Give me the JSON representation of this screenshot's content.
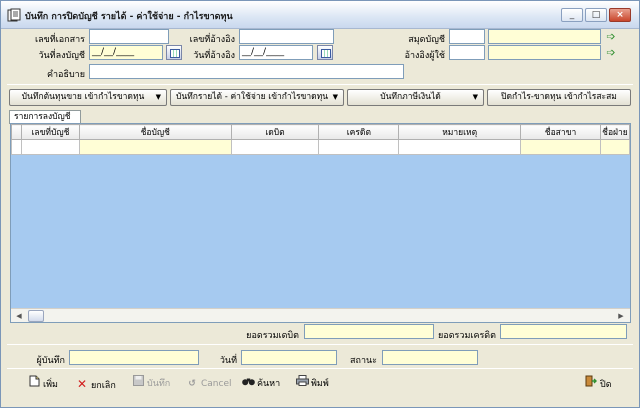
{
  "window": {
    "title": "บันทึก การปิดบัญชี รายได้ - ค่าใช้จ่าย - กำไรขาดทุน",
    "controls": {
      "minimize": "_",
      "maximize": "□",
      "close": "×"
    }
  },
  "form": {
    "doc_no_label": "เลขที่เอกสาร",
    "doc_no_value": "",
    "ref_no_label": "เลขที่อ้างอิง",
    "ref_no_value": "",
    "journal_label": "สมุดบัญชี",
    "journal_code": "",
    "journal_name": "",
    "post_date_label": "วันที่ลงบัญชี",
    "post_date_value": "__/__/____",
    "ref_date_label": "วันที่อ้างอิง",
    "ref_date_value": "__/__/____",
    "ref_person_label": "อ้างอิงผู้ใช้",
    "ref_person_code": "",
    "ref_person_name": "",
    "desc_label": "คำอธิบาย",
    "desc_value": ""
  },
  "toolbar": {
    "btn1": "บันทึกต้นทุนขาย เข้ากำไรขาดทุน",
    "btn2": "บันทึกรายได้ - ค่าใช้จ่าย เข้ากำไรขาดทุน",
    "btn3": "บันทึกภาษีเงินได้",
    "btn4": "ปิดกำไร-ขาดทุน เข้ากำไรสะสม",
    "dropdown_arrow": "▼"
  },
  "tab": {
    "label": "รายการลงบัญชี"
  },
  "grid": {
    "columns": [
      "เลขที่บัญชี",
      "ชื่อบัญชี",
      "เดบิต",
      "เครดิต",
      "หมายเหตุ",
      "ชื่อสาขา",
      "ชื่อฝ่าย"
    ],
    "rows": [
      [
        "",
        "",
        "",
        "",
        "",
        "",
        ""
      ]
    ]
  },
  "totals": {
    "debit_label": "ยอดรวมเดบิต",
    "debit_value": "",
    "credit_label": "ยอดรวมเครดิต",
    "credit_value": ""
  },
  "footer_fields": {
    "recorder_label": "ผู้บันทึก",
    "recorder_value": "",
    "date_label": "วันที่",
    "date_value": "",
    "status_label": "สถานะ",
    "status_value": ""
  },
  "actions": {
    "add": "เพิ่ม",
    "cancel_th": "ยกเลิก",
    "save": "บันทึก",
    "cancel_en": "Cancel",
    "search": "ค้นหา",
    "print": "พิมพ์",
    "close": "ปิด"
  },
  "icons": {
    "app": "ledger-icon",
    "lookup": "arrow-right-icon",
    "calendar": "calendar-icon",
    "add": "new-document-icon",
    "cancel": "red-x-icon",
    "save": "disk-icon",
    "cancel_en": "undo-icon",
    "search": "binoculars-icon",
    "print": "printer-icon",
    "close": "exit-door-icon"
  },
  "colors": {
    "required_field": "#fffed6",
    "grid_background": "#a6caf0",
    "window_bg": "#ece9d8"
  }
}
